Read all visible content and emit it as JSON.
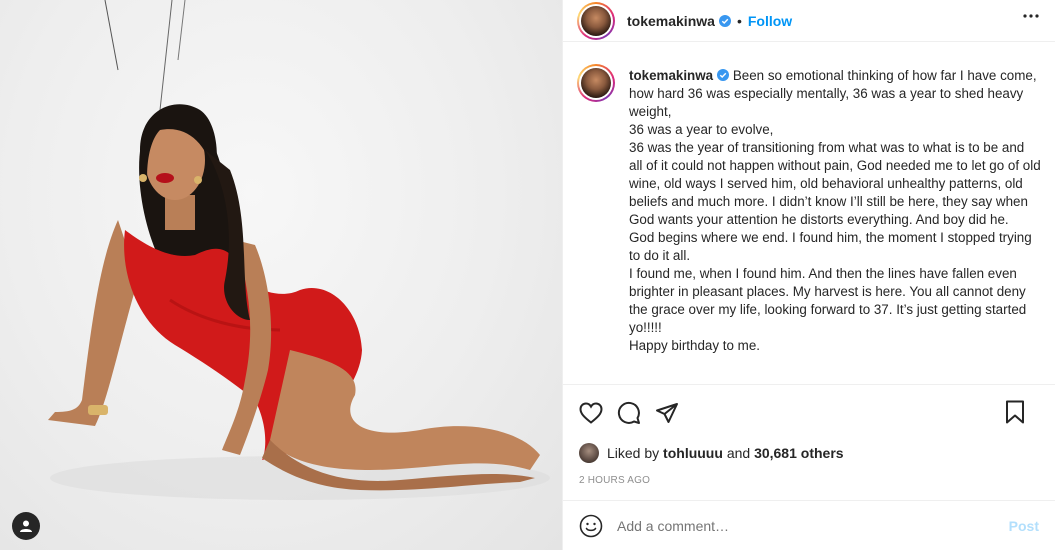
{
  "header": {
    "username": "tokemakinwa",
    "separator": "•",
    "follow_label": "Follow",
    "more_icon": "more-horizontal-icon"
  },
  "caption": {
    "username": "tokemakinwa",
    "paragraphs": [
      "Been so emotional thinking of how far I have come, how hard 36 was especially mentally, 36 was a year to shed heavy weight,",
      "36 was a year to evolve,",
      "36 was the year of transitioning from what was to what is to be and all of it could not happen without pain, God needed me to let go of old wine, old ways I served him, old behavioral unhealthy patterns, old beliefs and much more. I didn’t know I’ll still be here, they say when God wants your attention he distorts everything. And boy did he.",
      "God begins where we end. I found him, the moment I stopped trying to do it all.",
      "I found me, when I found him. And then the lines have fallen even brighter in pleasant places. My harvest is here. You all cannot deny the grace over my life, looking forward to 37. It’s just getting started yo!!!!!",
      "Happy birthday to me."
    ]
  },
  "likes": {
    "prefix": "Liked by",
    "user": "tohluuuu",
    "middle": "and",
    "count_text": "30,681 others"
  },
  "timestamp": "2 HOURS AGO",
  "comment": {
    "placeholder": "Add a comment…",
    "post_label": "Post"
  },
  "colors": {
    "accent": "#0095f6",
    "post_disabled": "#b2dffc",
    "dress": "#d11a1a"
  }
}
